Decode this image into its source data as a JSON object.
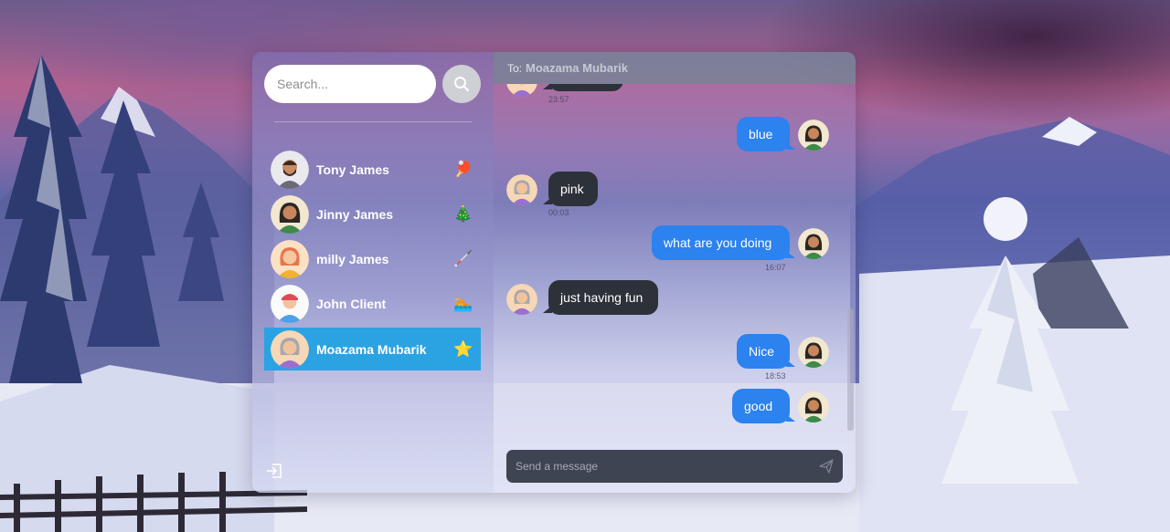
{
  "search": {
    "placeholder": "Search..."
  },
  "contacts": [
    {
      "name": "Tony James",
      "status_emoji": "🏓",
      "active": false
    },
    {
      "name": "Jinny James",
      "status_emoji": "🎄",
      "active": false
    },
    {
      "name": "milly James",
      "status_emoji": "🦯",
      "active": false
    },
    {
      "name": "John Client",
      "status_emoji": "🏊",
      "active": false
    },
    {
      "name": "Moazama Mubarik",
      "status_emoji": "⭐",
      "active": true
    }
  ],
  "chat": {
    "to_label": "To:",
    "recipient": "Moazama Mubarik",
    "messages": [
      {
        "direction": "in",
        "text": "",
        "time": "23:57"
      },
      {
        "direction": "out",
        "text": "blue",
        "time": ""
      },
      {
        "direction": "in",
        "text": "pink",
        "time": "00:03"
      },
      {
        "direction": "out",
        "text": "what are you doing",
        "time": "16:07"
      },
      {
        "direction": "in",
        "text": "just having fun",
        "time": ""
      },
      {
        "direction": "out",
        "text": "Nice",
        "time": "18:53"
      },
      {
        "direction": "out",
        "text": "good",
        "time": ""
      }
    ],
    "composer_placeholder": "Send a message"
  },
  "colors": {
    "active_contact": "#2ba3e2",
    "outgoing_bubble": "#2c82ee",
    "incoming_bubble": "#2d3139",
    "header": "#78829a"
  },
  "icons": {
    "search": "search-icon",
    "logout": "logout-icon",
    "send": "send-icon"
  }
}
